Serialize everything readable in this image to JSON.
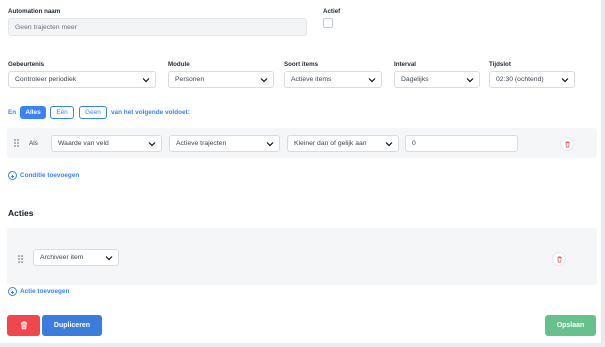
{
  "form": {
    "automation_name_label": "Automation naam",
    "automation_name_value": "Geen trajecten meer",
    "active_label": "Actief"
  },
  "trigger": {
    "event_label": "Gebeurtenis",
    "event_value": "Controleer periodiek",
    "module_label": "Module",
    "module_value": "Personen",
    "items_label": "Soort items",
    "items_value": "Actieve items",
    "interval_label": "Interval",
    "interval_value": "Dagelijks",
    "timeslot_label": "Tijdslot",
    "timeslot_value": "02:30 (ochtend)"
  },
  "conditions": {
    "prefix": "En",
    "mode_all": "Alles",
    "mode_one": "Eén",
    "mode_none": "Geen",
    "suffix": "van het volgende voldoet:",
    "row": {
      "als_label": "Als",
      "field_type": "Waarde van veld",
      "field": "Actieve trajecten",
      "operator": "Kleiner dan of gelijk aan",
      "value": "0"
    },
    "add_label": "Conditie toevoegen"
  },
  "actions": {
    "title": "Acties",
    "row": {
      "action": "Archiveer item"
    },
    "add_label": "Actie toevoegen"
  },
  "footer": {
    "duplicate_label": "Dupliceren",
    "save_label": "Opslaan"
  },
  "colors": {
    "accent": "#3b82f6",
    "danger": "#f0474f",
    "success": "#66c18c"
  },
  "icons": {
    "select": "chevron-down-icon",
    "delete": "trash-icon",
    "add": "plus-circle-icon",
    "drag": "drag-handle-icon"
  }
}
